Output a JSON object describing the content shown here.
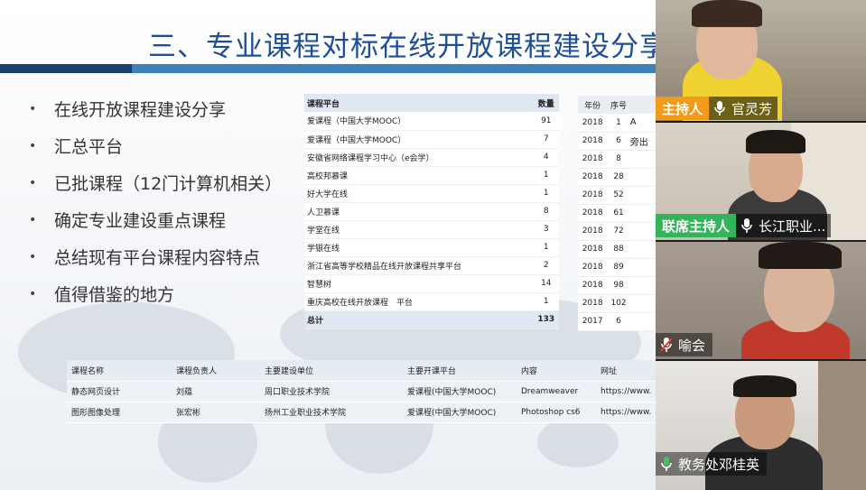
{
  "slide": {
    "title": "三、专业课程对标在线开放课程建设分享",
    "bullets": [
      "在线开放课程建设分享",
      "汇总平台",
      "已批课程（12门计算机相关）",
      "确定专业建设重点课程",
      "总结现有平台课程内容特点",
      "值得借鉴的地方"
    ],
    "platform_table": {
      "headers": [
        "课程平台",
        "数量"
      ],
      "rows": [
        [
          "爱课程（中国大学MOOC）",
          "91"
        ],
        [
          "爱课程（中国大学MOOC）",
          "7"
        ],
        [
          "安徽省网络课程学习中心（e会学）",
          "4"
        ],
        [
          "高校邦慕课",
          "1"
        ],
        [
          "好大学在线",
          "1"
        ],
        [
          "人卫慕课",
          "8"
        ],
        [
          "学堂在线",
          "3"
        ],
        [
          "学银在线",
          "1"
        ],
        [
          "浙江省高等学校精品在线开放课程共享平台",
          "2"
        ],
        [
          "智慧树",
          "14"
        ],
        [
          "重庆高校在线开放课程　平台",
          "1"
        ]
      ],
      "total_label": "总计",
      "total_value": "133"
    },
    "year_table": {
      "headers": [
        "年份",
        "序号"
      ],
      "rows": [
        [
          "2018",
          "1",
          "A"
        ],
        [
          "2018",
          "6",
          "旁出"
        ],
        [
          "2018",
          "8",
          ""
        ],
        [
          "2018",
          "28",
          ""
        ],
        [
          "2018",
          "52",
          ""
        ],
        [
          "2018",
          "61",
          ""
        ],
        [
          "2018",
          "72",
          ""
        ],
        [
          "2018",
          "88",
          ""
        ],
        [
          "2018",
          "89",
          ""
        ],
        [
          "2018",
          "98",
          ""
        ],
        [
          "2018",
          "102",
          ""
        ],
        [
          "2017",
          "6",
          ""
        ]
      ]
    },
    "course_table": {
      "headers": [
        "课程名称",
        "课程负责人",
        "主要建设单位",
        "主要开课平台",
        "内容",
        "网址"
      ],
      "rows": [
        [
          "静态网页设计",
          "刘蕴",
          "周口职业技术学院",
          "爱课程(中国大学MOOC)",
          "Dreamweaver",
          "https://www."
        ],
        [
          "图形图像处理",
          "张宏彬",
          "扬州工业职业技术学院",
          "爱课程(中国大学MOOC)",
          "Photoshop cs6",
          "https://www."
        ]
      ]
    }
  },
  "participants": [
    {
      "role": "主持人",
      "name": "官灵芳",
      "mic": "active"
    },
    {
      "role": "联席主持人",
      "name": "长江职业...",
      "mic": "active"
    },
    {
      "role": "",
      "name": "喻会",
      "mic": "muted"
    },
    {
      "role": "",
      "name": "教务处邓桂英",
      "mic": "active"
    }
  ],
  "colors": {
    "title": "#1f4e96",
    "bar_dark": "#1b3f6c",
    "bar_light": "#3e82bd",
    "host_tag": "#f29a1a",
    "cohost_tag": "#34b45a"
  }
}
